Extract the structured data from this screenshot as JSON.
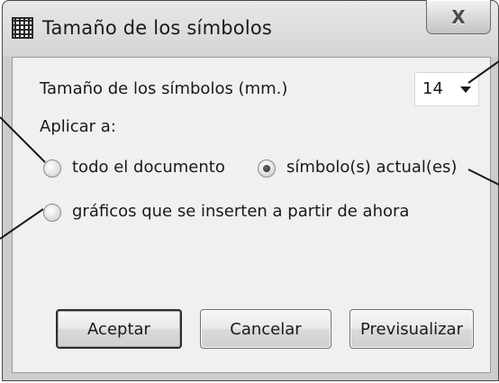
{
  "window": {
    "title": "Tamaño de los símbolos",
    "close_label": "X"
  },
  "form": {
    "size_label": "Tamaño de los símbolos (mm.)",
    "size_value": "14",
    "apply_label": "Aplicar a:",
    "options": {
      "whole_document": {
        "label": "todo el documento",
        "checked": false
      },
      "current_symbols": {
        "label": "símbolo(s) actual(es)",
        "checked": true
      },
      "future_graphics": {
        "label": "gráficos que se inserten a partir de ahora",
        "checked": false
      }
    }
  },
  "buttons": {
    "accept": "Aceptar",
    "cancel": "Cancelar",
    "preview": "Previsualizar"
  },
  "colors": {
    "client_background": "#f0f0f0",
    "frame": "#cdcdcd",
    "text": "#1a1a1a",
    "leader_lines": "#1a1a1a"
  },
  "icons": {
    "title_icon": "grid-icon",
    "dropdown_icon": "caret-down-icon"
  }
}
